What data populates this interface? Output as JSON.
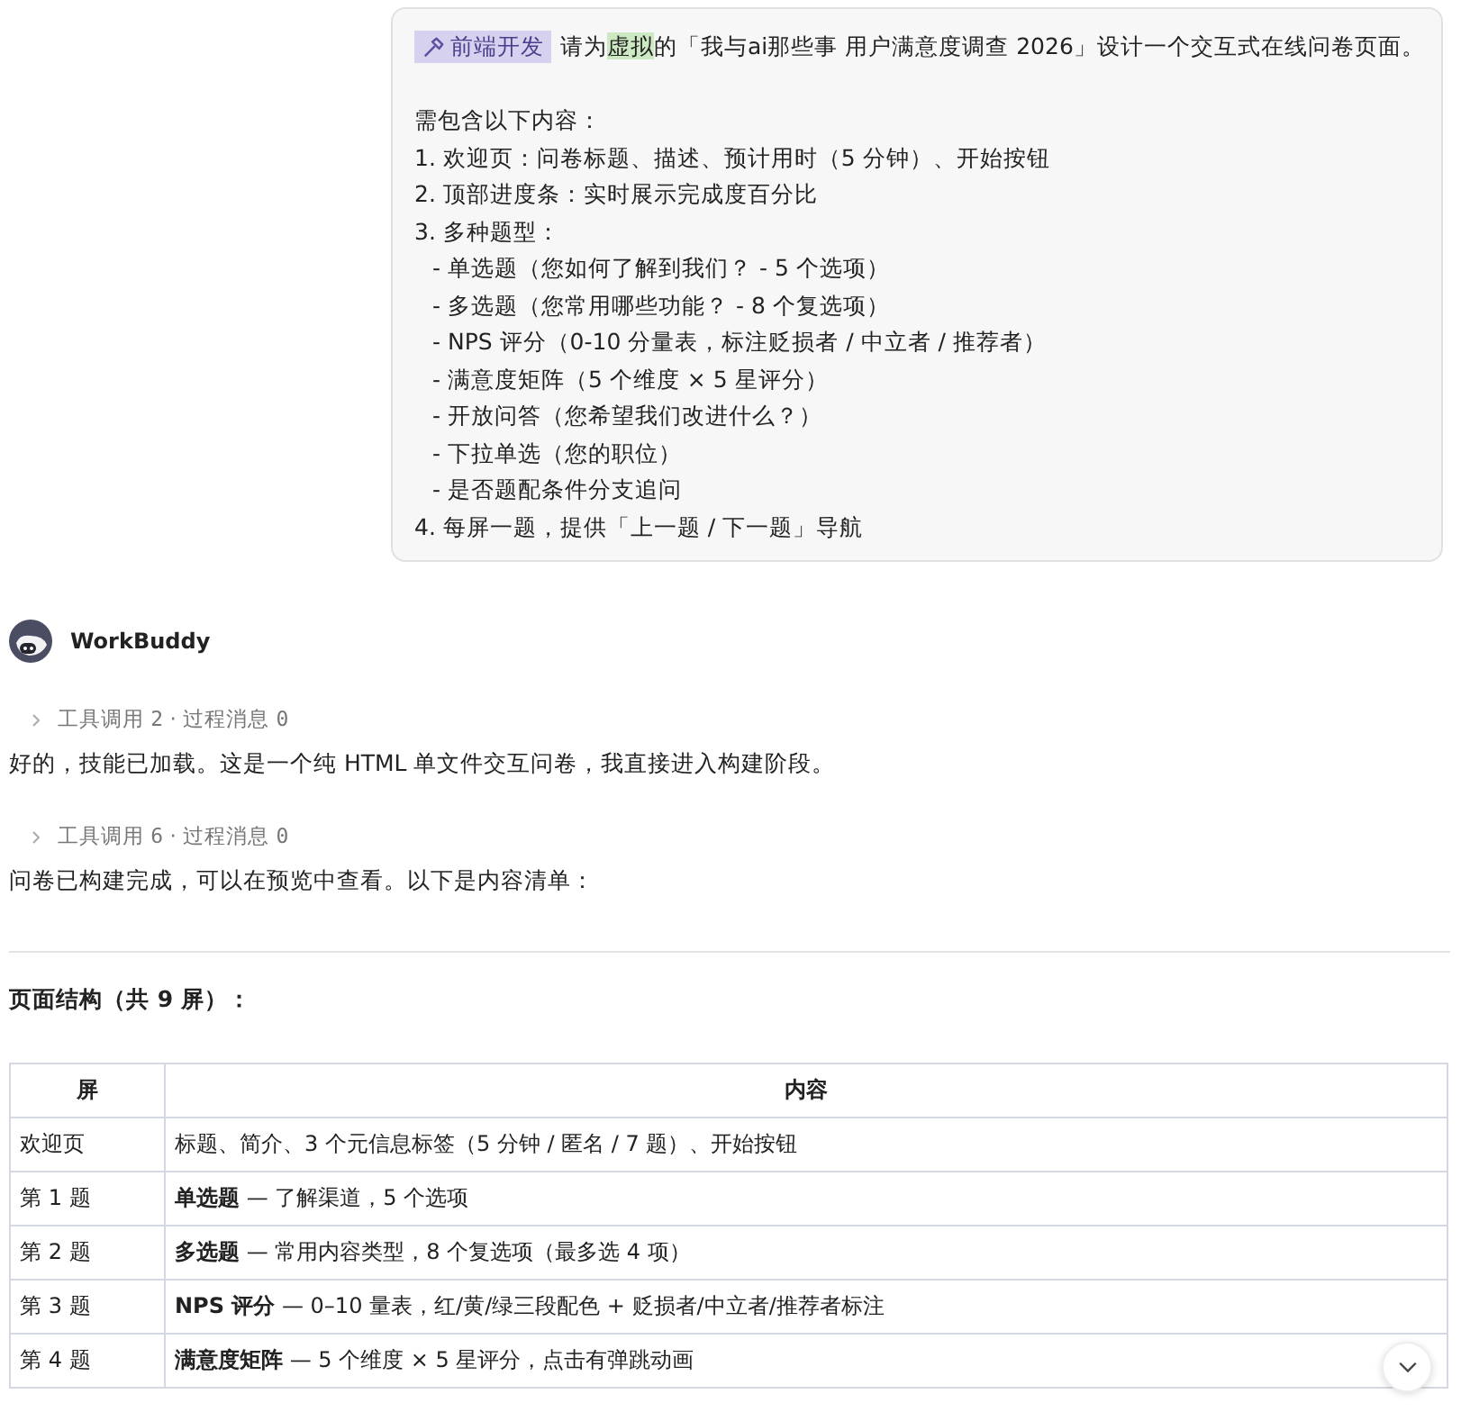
{
  "user_message": {
    "tag": "前端开发",
    "request": {
      "before": "请为",
      "highlight": "虚拟",
      "after": "的「我与ai那些事 用户满意度调查 2026」设计一个交互式在线问卷页面。"
    },
    "lines": [
      {
        "text": "需包含以下内容："
      },
      {
        "text": "1. 欢迎页：问卷标题、描述、预计用时（5 分钟）、开始按钮"
      },
      {
        "text": "2. 顶部进度条：实时展示完成度百分比"
      },
      {
        "text": "3. 多种题型：",
        "children": [
          {
            "text": "- 单选题（您如何了解到我们？ - 5 个选项）"
          },
          {
            "text": "- 多选题（您常用哪些功能？ - 8 个复选项）"
          },
          {
            "text": "- NPS 评分（0-10 分量表，标注贬损者 / 中立者 / 推荐者）"
          },
          {
            "text": "- 满意度矩阵（5 个维度 × 5 星评分）"
          },
          {
            "text": "- 开放问答（您希望我们改进什么？）"
          },
          {
            "text": "- 下拉单选（您的职位）"
          },
          {
            "text": "- 是否题配条件分支追问"
          }
        ]
      },
      {
        "text": "4. 每屏一题，提供「上一题 / 下一题」导航"
      }
    ]
  },
  "assistant": {
    "name": "WorkBuddy",
    "steps": [
      {
        "tool_label": "工具调用",
        "tool_count": "2",
        "separator": "·",
        "process_label": "过程消息",
        "process_count": "0",
        "expanded": false,
        "text": "好的，技能已加载。这是一个纯 HTML 单文件交互问卷，我直接进入构建阶段。"
      },
      {
        "tool_label": "工具调用",
        "tool_count": "6",
        "separator": "·",
        "process_label": "过程消息",
        "process_count": "0",
        "expanded": false,
        "text": "问卷已构建完成，可以在预览中查看。以下是内容清单："
      }
    ],
    "section_title": "页面结构（共 9 屏）：",
    "table": {
      "columns": [
        "屏",
        "内容"
      ],
      "rows": [
        [
          "欢迎页",
          "标题、简介、3 个元信息标签（5 分钟 / 匿名 / 7 题）、开始按钮"
        ],
        [
          "第 1 题",
          "**单选题** — 了解渠道，5 个选项"
        ],
        [
          "第 2 题",
          "**多选题** — 常用内容类型，8 个复选项（最多选 4 项）"
        ],
        [
          "第 3 题",
          "**NPS 评分** — 0–10 量表，红/黄/绿三段配色 + 贬损者/中立者/推荐者标注"
        ],
        [
          "第 4 题",
          "**满意度矩阵** — 5 个维度 × 5 星评分，点击有弹跳动画"
        ]
      ]
    }
  }
}
